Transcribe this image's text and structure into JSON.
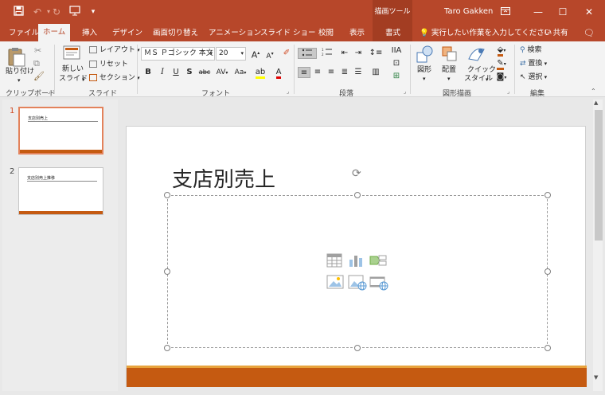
{
  "window": {
    "user": "Taro Gakken",
    "contextual_tab_group": "描画ツール",
    "contextual_tab": "書式",
    "share": "共有",
    "tell_me": "実行したい作業を入力してください"
  },
  "tabs": [
    "ファイル",
    "ホーム",
    "挿入",
    "デザイン",
    "画面切り替え",
    "アニメーション",
    "スライド ショー",
    "校閲",
    "表示"
  ],
  "ribbon": {
    "clipboard": {
      "paste": "貼り付け",
      "label": "クリップボード"
    },
    "slides": {
      "new_slide_1": "新しい",
      "new_slide_2": "スライド",
      "layout": "レイアウト",
      "reset": "リセット",
      "section": "セクション",
      "label": "スライド"
    },
    "font": {
      "font_name": "ＭＳ Ｐゴシック 本文",
      "font_size": "20",
      "label": "フォント",
      "bold": "B",
      "italic": "I",
      "underline": "U",
      "shadow": "S",
      "strike": "abc",
      "spacing": "AV",
      "case": "Aa",
      "grow": "A",
      "shrink": "A"
    },
    "paragraph": {
      "label": "段落"
    },
    "drawing": {
      "shapes": "図形",
      "arrange": "配置",
      "quick_styles_1": "クイック",
      "quick_styles_2": "スタイル",
      "label": "図形描画"
    },
    "editing": {
      "find": "検索",
      "replace": "置換",
      "select": "選択",
      "label": "編集"
    }
  },
  "thumbnails": [
    {
      "number": "1",
      "title": "支店別売上"
    },
    {
      "number": "2",
      "title": "支店別売上推移"
    }
  ],
  "slide": {
    "title": "支店別売上"
  },
  "colors": {
    "accent": "#b7472a",
    "band": "#c55a11",
    "band_light": "#e8a33c"
  }
}
